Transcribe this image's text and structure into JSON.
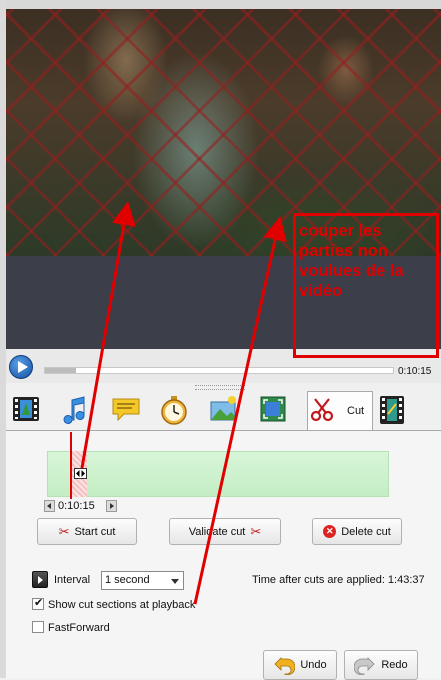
{
  "player": {
    "time": "0:10:15",
    "progress_percent": 9
  },
  "annotation": {
    "text": "couper les parties non voulues de la vidéo",
    "color": "#e00000"
  },
  "tabs": [
    {
      "name": "video-tab",
      "icon": "film-icon"
    },
    {
      "name": "audio-tab",
      "icon": "music-note-icon"
    },
    {
      "name": "subtitles-tab",
      "icon": "speech-bubble-icon"
    },
    {
      "name": "timer-tab",
      "icon": "stopwatch-icon"
    },
    {
      "name": "effects-tab",
      "icon": "image-sparkle-icon"
    },
    {
      "name": "crop-tab",
      "icon": "crop-icon"
    },
    {
      "name": "cut-tab",
      "icon": "scissors-icon",
      "label": "Cut",
      "active": true
    },
    {
      "name": "transitions-tab",
      "icon": "film-swap-icon"
    }
  ],
  "cut": {
    "position_time": "0:10:15",
    "start_cut_label": "Start cut",
    "validate_cut_label": "Validate cut",
    "delete_cut_label": "Delete cut",
    "interval_label": "Interval",
    "interval_value": "1 second",
    "time_after_cuts": "Time after cuts are applied: 1:43:37",
    "show_cut_sections_label": "Show cut sections at playback",
    "show_cut_sections_checked": true,
    "fastforward_label": "FastForward",
    "fastforward_checked": false
  },
  "footer": {
    "undo_label": "Undo",
    "redo_label": "Redo"
  },
  "colors": {
    "accent_red": "#e00000",
    "timeline_green": "#c4eec4",
    "dark_panel": "#3c3e4a"
  }
}
